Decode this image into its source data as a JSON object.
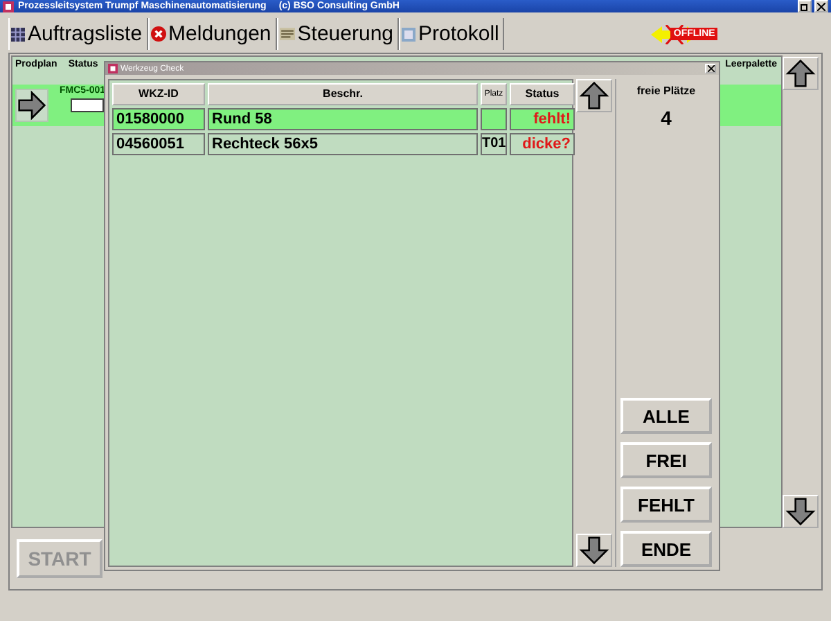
{
  "window": {
    "title": "Prozessleitsystem Trumpf Maschinenautomatisierung",
    "copyright": "(c) BSO Consulting GmbH"
  },
  "tabs": [
    {
      "label": "Auftragsliste"
    },
    {
      "label": "Meldungen"
    },
    {
      "label": "Steuerung"
    },
    {
      "label": "Protokoll"
    }
  ],
  "connection": {
    "label": "OFFLINE",
    "online": false
  },
  "order_list": {
    "columns": [
      "Prodplan",
      "Status",
      "Leerpalette"
    ],
    "rows": [
      {
        "order": "FMC5-001",
        "selected": true
      }
    ]
  },
  "start_button": {
    "label": "START",
    "disabled": true
  },
  "dialog": {
    "title": "Werkzeug Check",
    "columns": [
      "WKZ-ID",
      "Beschr.",
      "Platz",
      "Status"
    ],
    "rows": [
      {
        "id": "01580000",
        "description": "Rund 58",
        "status": "fehlt!",
        "selected": true
      },
      {
        "id": "04560051",
        "description": "Rechteck 56x5",
        "place": "T01",
        "status": "dicke?",
        "selected": false
      }
    ],
    "free_label": "freie Plätze",
    "free_count": "4",
    "buttons": [
      "ALLE",
      "FREI",
      "FEHLT",
      "ENDE"
    ]
  }
}
